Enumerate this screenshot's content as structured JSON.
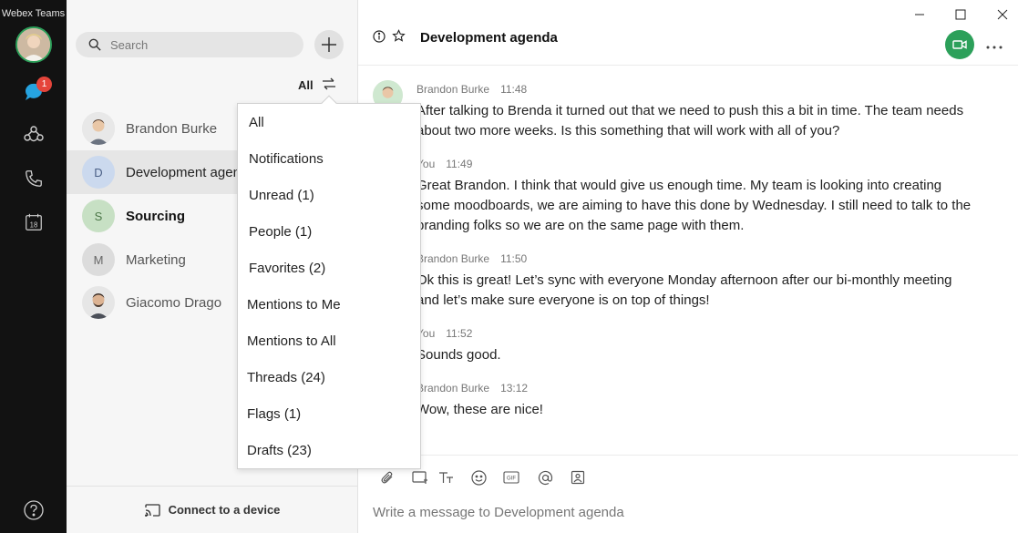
{
  "app": {
    "title": "Webex Teams"
  },
  "rail": {
    "unread_badge": "1",
    "calendar_day": "18"
  },
  "list": {
    "search_placeholder": "Search",
    "filter_label": "All",
    "spaces": [
      {
        "name": "Brandon Burke",
        "initial": "",
        "bold": false
      },
      {
        "name": "Development agen",
        "initial": "D",
        "bold": false
      },
      {
        "name": "Sourcing",
        "initial": "S",
        "bold": true
      },
      {
        "name": "Marketing",
        "initial": "M",
        "bold": false
      },
      {
        "name": "Giacomo Drago",
        "initial": "",
        "bold": false
      }
    ],
    "connect_label": "Connect to a device"
  },
  "dropdown": {
    "items": [
      "All",
      "Notifications",
      "Unread (1)",
      "People (1)",
      "Favorites (2)",
      "Mentions to Me",
      "Mentions to All",
      "Threads (24)",
      "Flags (1)",
      "Drafts (23)"
    ]
  },
  "conversation": {
    "title": "Development agenda",
    "messages": [
      {
        "sender": "Brandon Burke",
        "time": "11:48",
        "text_lines": [
          "After talking to Brenda it turned out that we need to push this a bit in time. The team needs",
          "about two more weeks. Is this something that will work with all of you?"
        ]
      },
      {
        "sender": "You",
        "time": "11:49",
        "text_lines": [
          "Great Brandon. I think that would give us enough time. My team is looking into creating",
          "some moodboards, we are aiming to have this done by Wednesday. I still need to talk to the",
          "branding folks so we are on the same page with them."
        ]
      },
      {
        "sender": "Brandon Burke",
        "time": "11:50",
        "text_lines": [
          "Ok this is great! Let’s sync with everyone Monday afternoon after our bi-monthly meeting",
          "and let’s make sure everyone is on top of things!"
        ]
      },
      {
        "sender": "You",
        "time": "11:52",
        "text_lines": [
          "Sounds good."
        ]
      },
      {
        "sender": "Brandon Burke",
        "time": "13:12",
        "text_lines": [
          "Wow, these are nice!"
        ]
      }
    ],
    "composer_placeholder": "Write a message to Development agenda"
  },
  "colors": {
    "accent_green": "#2ca05a",
    "badge_red": "#e5453b",
    "rail_bg": "#121212"
  }
}
